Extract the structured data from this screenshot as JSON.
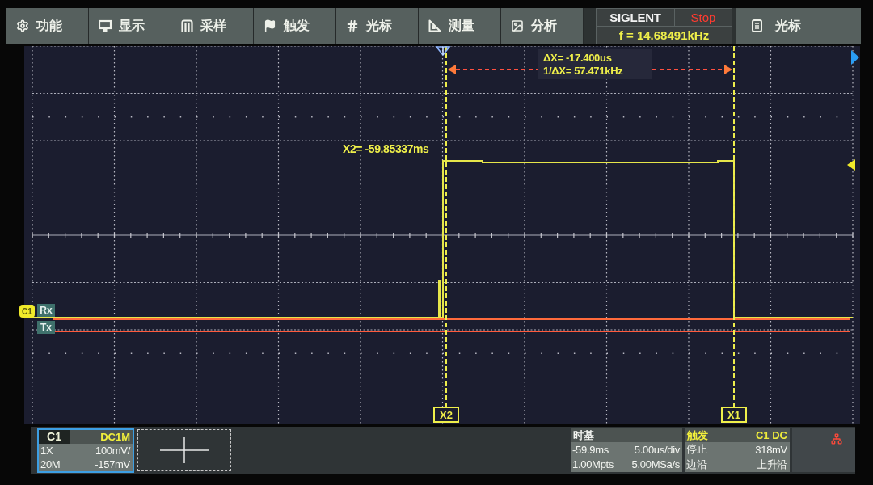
{
  "menu_bar": {
    "items": [
      {
        "label": "功能"
      },
      {
        "label": "显示"
      },
      {
        "label": "采样"
      },
      {
        "label": "触发"
      },
      {
        "label": "光标"
      },
      {
        "label": "测量"
      },
      {
        "label": "分析"
      }
    ]
  },
  "status": {
    "brand": "SIGLENT",
    "run_state": "Stop",
    "frequency": "f = 14.68491kHz"
  },
  "active_menu": {
    "label": "光标"
  },
  "display": {
    "channel_marker": "C1",
    "trace_labels": [
      "Rx",
      "Tx"
    ],
    "cursor_readout": {
      "delta_x": "ΔX= -17.400us",
      "inverse_delta_x": "1/ΔX= 57.471kHz"
    },
    "cursor_value": "X2= -59.85337ms",
    "cursors": [
      {
        "label": "X2"
      },
      {
        "label": "X1"
      }
    ]
  },
  "channel": {
    "name": "C1",
    "coupling": "DC1M",
    "probe": "1X",
    "scale": "100mV/",
    "bandwidth": "20M",
    "offset": "-157mV"
  },
  "timebase": {
    "title": "时基",
    "delay": "-59.9ms",
    "scale": "5.00us/div",
    "memory_depth": "1.00Mpts",
    "sample_rate": "5.00MSa/s"
  },
  "trigger": {
    "title": "触发",
    "source": "C1 DC",
    "state": "停止",
    "level": "318mV",
    "type": "边沿",
    "slope": "上升沿"
  }
}
